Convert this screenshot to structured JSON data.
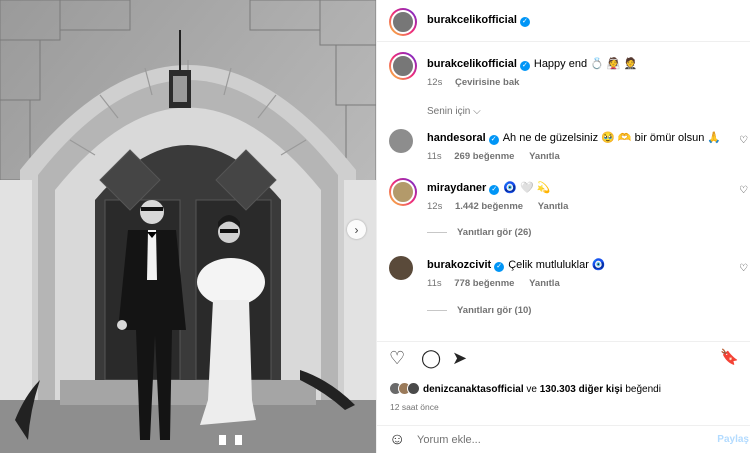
{
  "post": {
    "author": "burakcelikofficial",
    "caption_user": "burakcelikofficial",
    "caption": "Happy end 💍 👰 🤵",
    "caption_age": "12s",
    "translate_label": "Çevirisine bak",
    "filter_label": "Senin için",
    "filter_chevron": "⌵"
  },
  "comments": [
    {
      "user": "handesoral",
      "text": "Ah ne de güzelsiniz 🥹 🫶 bir ömür olsun 🙏",
      "age": "11s",
      "likes": "269 beğenme",
      "reply": "Yanıtla",
      "avatar_color": "#8d8d8d"
    },
    {
      "user": "miraydaner",
      "text": "🧿 🤍 💫",
      "age": "12s",
      "likes": "1.442 beğenme",
      "reply": "Yanıtla",
      "avatar_color": "#b39a6a"
    },
    {
      "user": "burakozcivit",
      "text": "Çelik mutluluklar 🧿",
      "age": "11s",
      "likes": "778 beğenme",
      "reply": "Yanıtla",
      "avatar_color": "#5a4a3a"
    }
  ],
  "replies": [
    {
      "label": "Yanıtları gör (26)"
    },
    {
      "label": "Yanıtları gör (10)"
    }
  ],
  "likes": {
    "first_user": "denizcanaktasofficial",
    "connector": "ve",
    "count_text": "130.303 diğer kişi",
    "suffix": "beğendi"
  },
  "timestamp": "12 saat önce",
  "comment_input": {
    "placeholder": "Yorum ekle...",
    "post_label": "Paylaş"
  },
  "icons": {
    "verified": "✓",
    "heart": "♡",
    "comment": "◯",
    "share": "➤",
    "bookmark": "🔖",
    "emoji": "☺",
    "next": "›"
  },
  "colors": {
    "accent": "#0095f6",
    "muted": "#737373"
  }
}
